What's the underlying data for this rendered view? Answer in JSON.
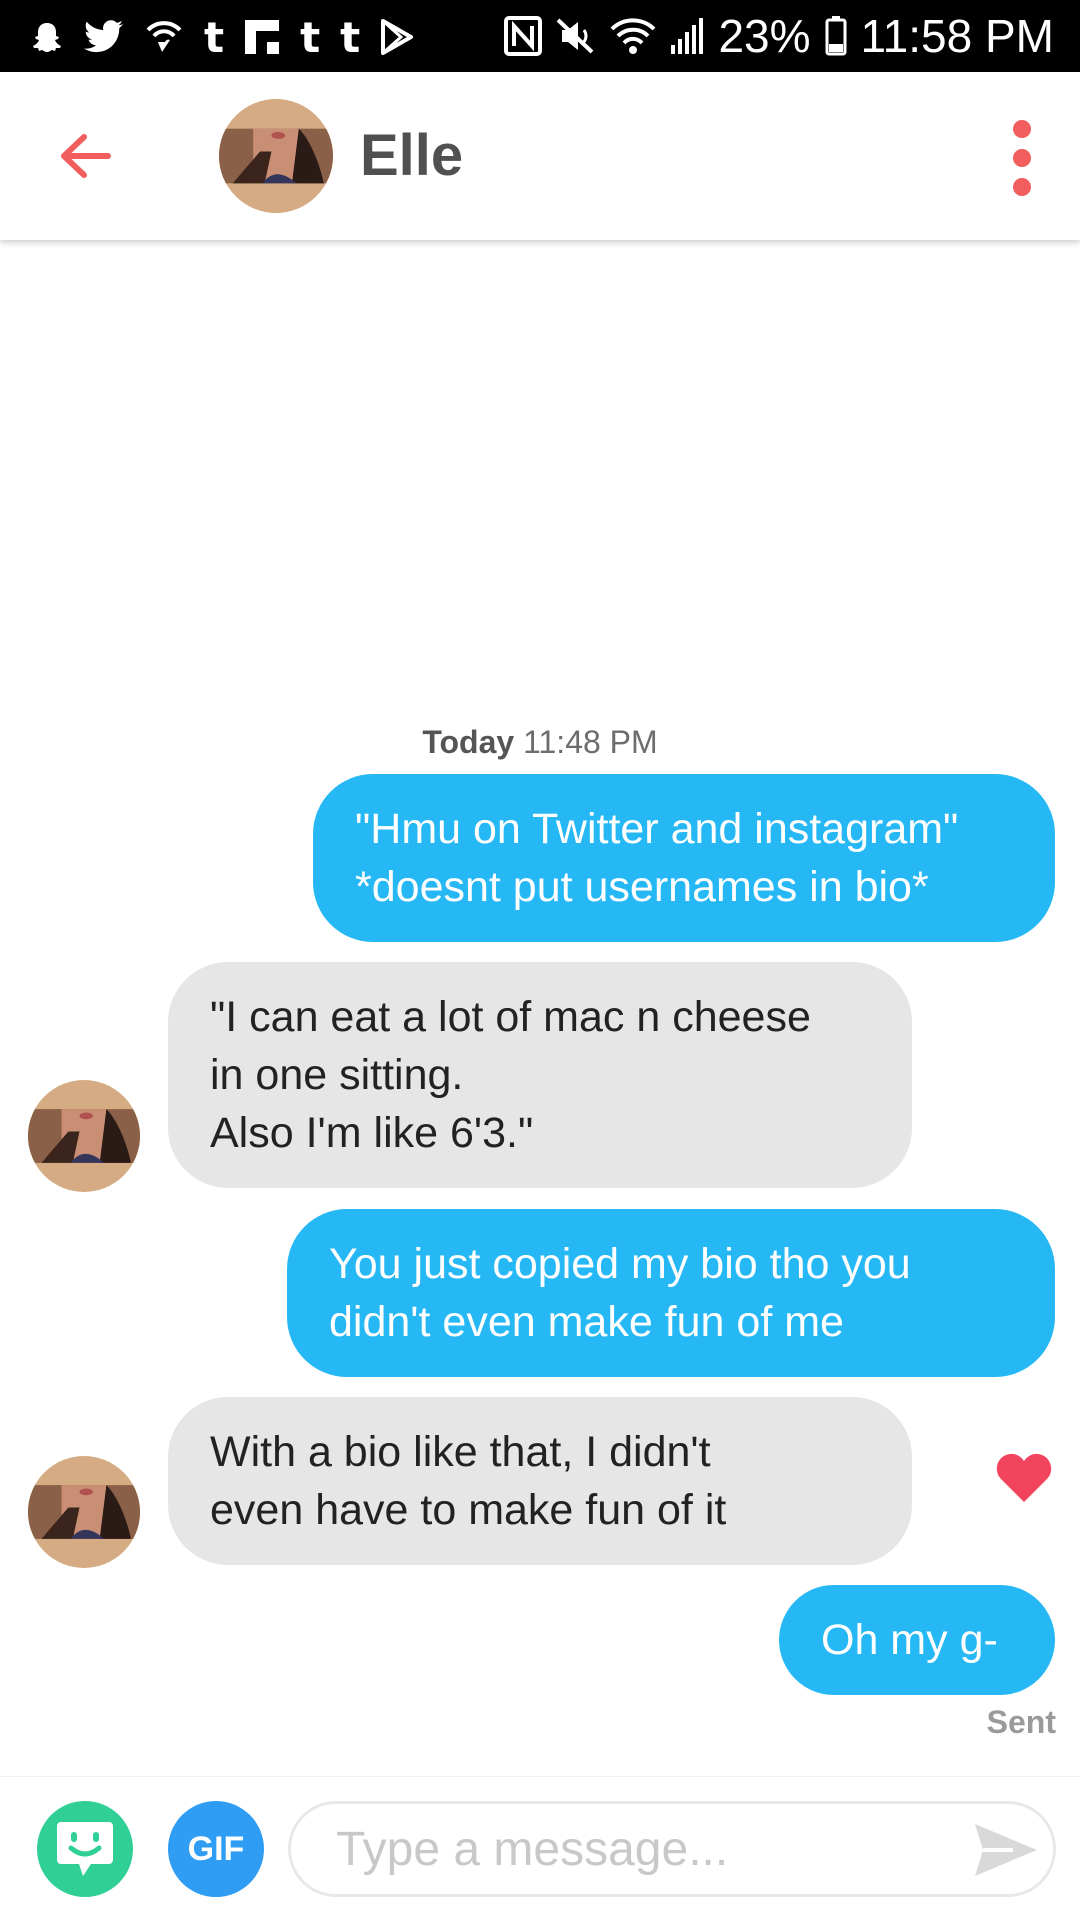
{
  "status_bar": {
    "left_icons": [
      "snapchat-icon",
      "twitter-icon",
      "wifi-call-icon",
      "tumblr-icon",
      "flipboard-icon",
      "tumblr-icon",
      "tumblr-icon",
      "play-store-icon"
    ],
    "tumblr_glyph": "t",
    "right_icons": [
      "nfc-icon",
      "mute-icon",
      "wifi-icon",
      "signal-icon",
      "battery-icon"
    ],
    "battery": "23%",
    "time": "11:58 PM"
  },
  "header": {
    "contact_name": "Elle",
    "accent_color": "#f25d5d"
  },
  "conversation": {
    "date_label": "Today",
    "time_label": "11:48 PM",
    "messages": [
      {
        "direction": "out",
        "text": "\"Hmu on Twitter and instagram\"\n*doesnt put usernames in bio*"
      },
      {
        "direction": "in",
        "text": "\"I can eat a lot of mac n cheese\nin one sitting.\nAlso I'm like 6'3.\""
      },
      {
        "direction": "out",
        "text": "You just copied my bio tho you\ndidn't even make fun of me"
      },
      {
        "direction": "in",
        "text": "With a bio like that, I didn't\neven have to make fun of it",
        "liked": true
      },
      {
        "direction": "out",
        "text": "Oh my g-"
      }
    ],
    "sent_label": "Sent",
    "outgoing_color": "#25b8f4",
    "incoming_color": "#e6e6e6",
    "like_color": "#f2445c"
  },
  "input_bar": {
    "gif_label": "GIF",
    "placeholder": "Type a message...",
    "sticker_color": "#2fcf96",
    "gif_color": "#2e9df3"
  }
}
